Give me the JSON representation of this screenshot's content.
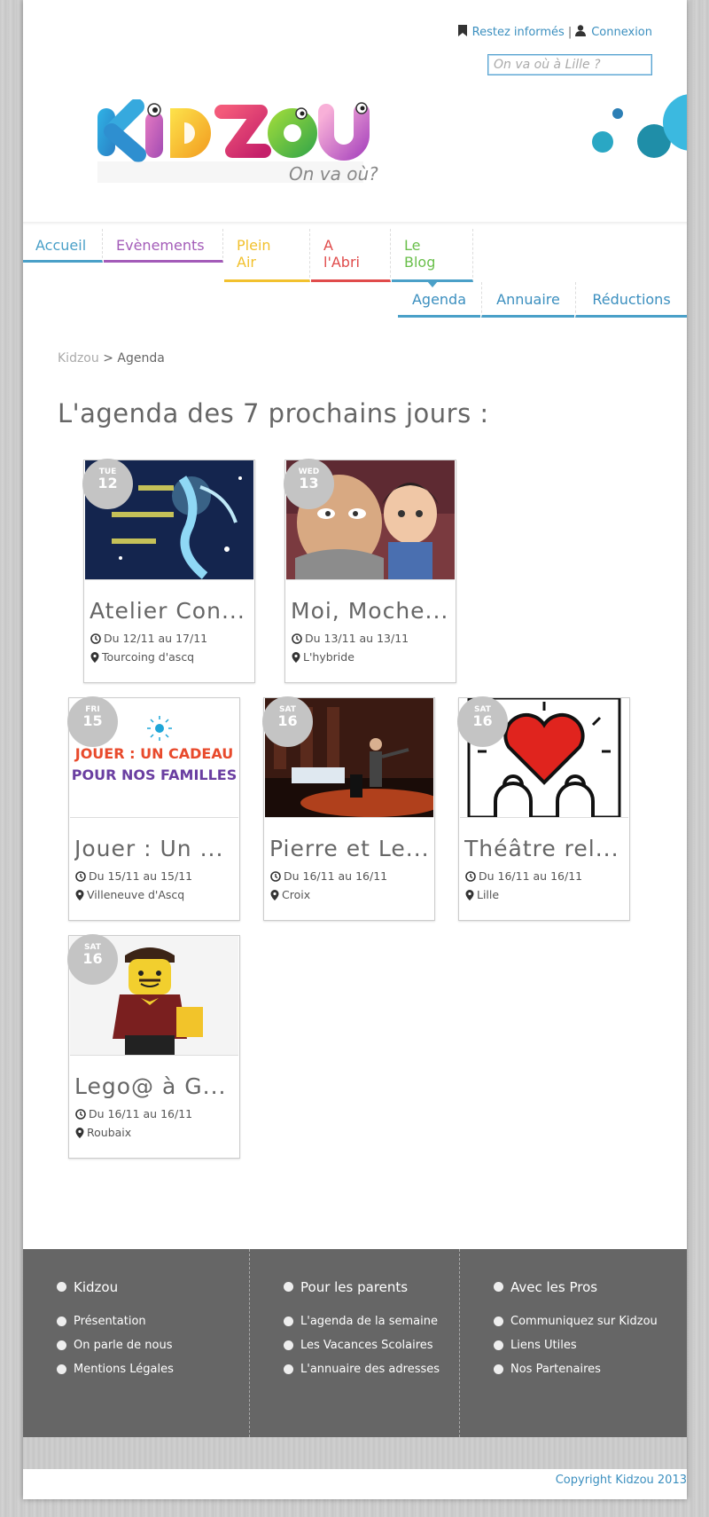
{
  "header": {
    "newsletter_label": "Restez informés",
    "separator": "|",
    "login_label": "Connexion",
    "search_placeholder": "On va où à Lille ?",
    "logo_text": "KIDZOU",
    "tagline": "On va où?"
  },
  "nav": {
    "items": [
      {
        "label": "Accueil",
        "color": "#4aa0c8"
      },
      {
        "label": "Evènements",
        "color": "#a35bb8"
      },
      {
        "label": "Plein\nAir",
        "color": "#f2c12e"
      },
      {
        "label": "A\nl'Abri",
        "color": "#e04b4b"
      },
      {
        "label": "Le\nBlog",
        "color": "#6abf4b"
      }
    ],
    "sub_items": [
      "Agenda",
      "Annuaire",
      "Réductions"
    ]
  },
  "breadcrumb": {
    "home": "Kidzou",
    "separator": ">",
    "current": "Agenda"
  },
  "page_title": "L'agenda des 7 prochains jours :",
  "events": [
    {
      "dow": "TUE",
      "day": "12",
      "title": "Atelier Con...",
      "dates": "Du 12/11 au 17/11",
      "place": "Tourcoing d'ascq",
      "image": "mille-et-une-nuits-poster"
    },
    {
      "dow": "WED",
      "day": "13",
      "title": "Moi, Moche...",
      "dates": "Du 13/11 au 13/11",
      "place": "L'hybride",
      "image": "despicable-me-still"
    },
    {
      "dow": "FRI",
      "day": "15",
      "title": "Jouer : Un ...",
      "dates": "Du 15/11 au 15/11",
      "place": "Villeneuve d'Ascq",
      "image": "jouer-un-cadeau-poster",
      "image_text_1": "JOUER : UN CADEAU",
      "image_text_2": "POUR NOS FAMILLES"
    },
    {
      "dow": "SAT",
      "day": "16",
      "title": "Pierre et Le...",
      "dates": "Du 16/11 au 16/11",
      "place": "Croix",
      "image": "stage-performance-photo"
    },
    {
      "dow": "SAT",
      "day": "16",
      "title": "Théâtre rel...",
      "dates": "Du 16/11 au 16/11",
      "place": "Lille",
      "image": "keith-haring-heart"
    },
    {
      "dow": "SAT",
      "day": "16",
      "title": "Lego@ à G...",
      "dates": "Du 16/11 au 16/11",
      "place": "Roubaix",
      "image": "lego-minifigure-photo"
    }
  ],
  "footer": {
    "columns": [
      {
        "head": "Kidzou",
        "links": [
          "Présentation",
          "On parle de nous",
          "Mentions Légales"
        ]
      },
      {
        "head": "Pour les parents",
        "links": [
          "L'agenda de la semaine",
          "Les Vacances Scolaires",
          "L'annuaire des adresses"
        ]
      },
      {
        "head": "Avec les Pros",
        "links": [
          "Communiquez sur Kidzou",
          "Liens Utiles",
          "Nos Partenaires"
        ]
      }
    ],
    "copyright": "Copyright Kidzou 2013"
  },
  "colors": {
    "accent": "#3b8fbf",
    "badge": "#c4c4c4",
    "footer_bg": "#666666"
  }
}
